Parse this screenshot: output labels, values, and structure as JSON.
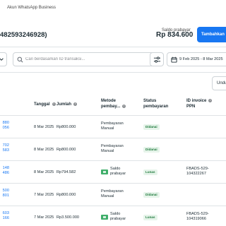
{
  "breadcrumb": "Akun WhatsApp Business",
  "account_id": "482593246928)",
  "balance": {
    "label": "Saldo prabayar",
    "value": "Rp 834.600"
  },
  "add_funds_label": "Tambahkan",
  "search": {
    "placeholder": "Cari berdasarkan ID transaksi..."
  },
  "date_range": "9 Feb 2025 - 8 Mar 2025",
  "download_label": "Undu",
  "columns": {
    "date": "Tanggal",
    "amount": "Jumlah",
    "method": [
      "Metode",
      "pembay..."
    ],
    "status": [
      "Status",
      "pembayaran"
    ],
    "invoice": [
      "ID invoice",
      "PPN"
    ]
  },
  "rows": [
    {
      "tx": [
        "880",
        "056"
      ],
      "date": "8 Mar 2025",
      "amount": "Rp800.000",
      "method": [
        "Pembayaran",
        "Manual"
      ],
      "method_icon": false,
      "status": "Didanai",
      "invoice": [
        "",
        ""
      ]
    },
    {
      "tx": [
        "702",
        "583"
      ],
      "date": "8 Mar 2025",
      "amount": "Rp800.000",
      "method": [
        "Pembayaran",
        "Manual"
      ],
      "method_icon": false,
      "status": "Didanai",
      "invoice": [
        "",
        ""
      ]
    },
    {
      "tx": [
        "148",
        "486"
      ],
      "date": "8 Mar 2025",
      "amount": "Rp794.582",
      "method": [
        "Saldo",
        "prabayar"
      ],
      "method_icon": true,
      "status": "Lunas",
      "invoice": [
        "FBADS-529-",
        "104322267"
      ]
    },
    {
      "tx": [
        "500",
        "801"
      ],
      "date": "7 Mar 2025",
      "amount": "Rp800.000",
      "method": [
        "Pembayaran",
        "Manual"
      ],
      "method_icon": false,
      "status": "Didanai",
      "invoice": [
        "",
        ""
      ]
    },
    {
      "tx": [
        "603",
        "166"
      ],
      "date": "7 Mar 2025",
      "amount": "Rp3.500.000",
      "method": [
        "Saldo",
        "prabayar"
      ],
      "method_icon": true,
      "status": "Lunas",
      "invoice": [
        "FBADS-529-",
        "104319066"
      ]
    }
  ]
}
